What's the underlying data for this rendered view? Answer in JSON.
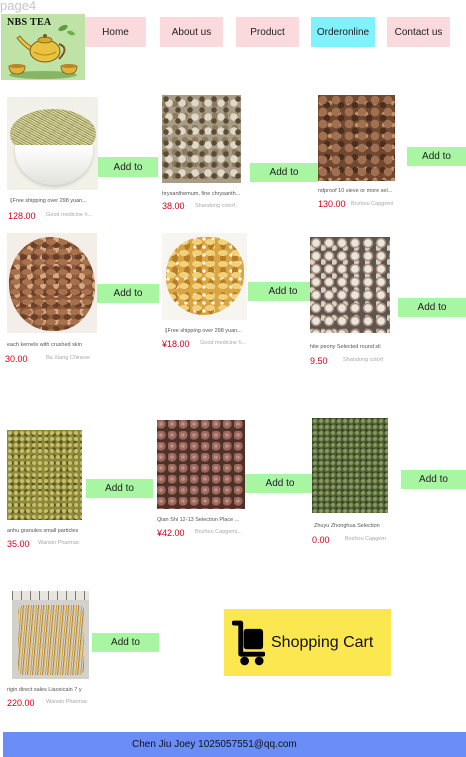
{
  "page_label": "page4",
  "logo": {
    "text": "NBS TEA",
    "icon": "teapot-logo"
  },
  "nav": {
    "items": [
      {
        "label": "Home"
      },
      {
        "label": "About us"
      },
      {
        "label": "Product"
      },
      {
        "label": "Orderonline",
        "active": true
      },
      {
        "label": "Contact us"
      }
    ]
  },
  "products": [
    {
      "title": "【Free shipping over 298 yuan...",
      "price": "128.00",
      "seller": "Good medicine h...",
      "button": "Add to"
    },
    {
      "title": "hrysanthemum, fine chrysanth...",
      "price": "38.00",
      "seller": "Shandong colorf..",
      "button": "Add to"
    },
    {
      "title": "ndproof 10 sieve or more sel...",
      "price": "130.00",
      "seller": "Bozhou Capgemi",
      "button": "Add to"
    },
    {
      "title": "each kernels with crushed skin",
      "price": "30.00",
      "seller": "Ba Xiang Chinese",
      "button": "Add to"
    },
    {
      "title": "【Free shipping over 298 yuan...",
      "price": "¥18.00",
      "seller": "Good medicine h...",
      "button": "Add to"
    },
    {
      "title": "hite peony Selected round sli",
      "price": "9.50",
      "seller": "Shandong colorf",
      "button": "Add to"
    },
    {
      "title": "anhu granules small particles",
      "price": "35.00",
      "seller": "Wanxin Pharmac",
      "button": "Add to"
    },
    {
      "title": "Qian Shi 12-13 Selection Place ...",
      "price": "¥42.00",
      "seller": "Bozhou Capgemi...",
      "button": "Add to"
    },
    {
      "title": "Zhuyu Zhonghua Selection",
      "price": "0.00",
      "seller": "Bozhou Capgem",
      "button": "Add to"
    },
    {
      "title": "rigin direct sales Liaoxicain 7 y",
      "price": "220.00",
      "seller": "Wanxin Pharmac",
      "button": "Add to"
    }
  ],
  "cart": {
    "label": "Shopping Cart",
    "icon": "shopping-cart-icon"
  },
  "footer": {
    "text": "Chen Jiu Joey 1025057551@qq.com"
  },
  "colors": {
    "nav_bg": "#fadadd",
    "nav_active_bg": "#7ff2fb",
    "add_button_bg": "#a8f5a2",
    "price": "#d0021b",
    "cart_bg": "#fbe74f",
    "footer_bg": "#6b8df8"
  }
}
